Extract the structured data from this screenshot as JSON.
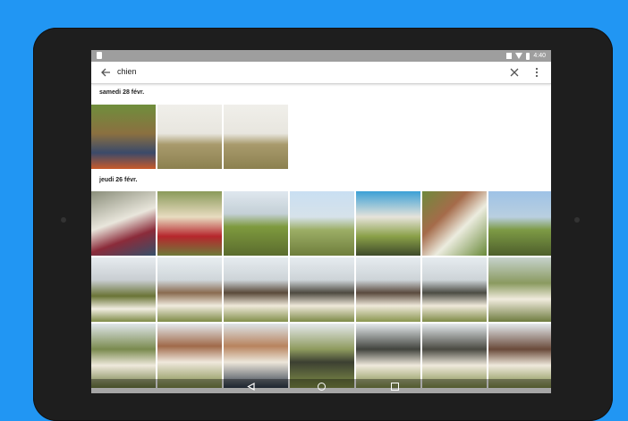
{
  "status_bar": {
    "time": "4:40"
  },
  "search": {
    "query": "chien"
  },
  "sections": [
    {
      "title": "samedi 28 févr."
    },
    {
      "title": "jeudi 26 févr."
    }
  ],
  "colors": {
    "background": "#2196F3",
    "tablet_bezel": "#1e1e1e",
    "status_bar": "#9e9e9e"
  }
}
